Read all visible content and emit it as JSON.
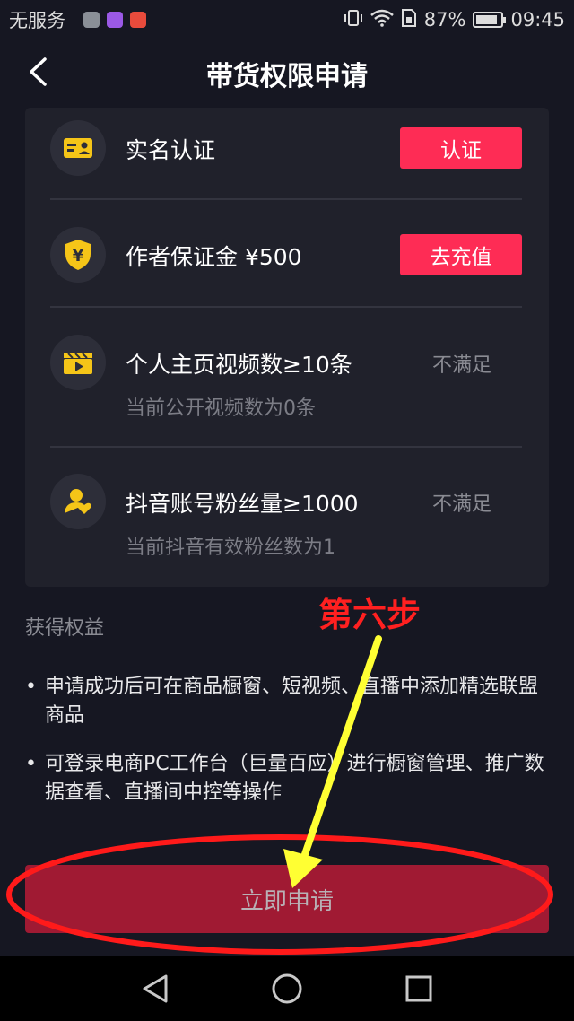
{
  "status_bar": {
    "carrier": "无服务",
    "battery": "87%",
    "battery_level": 0.87,
    "time": "09:45",
    "app_icon_colors": [
      "#8a8f97",
      "#9b59e6",
      "#e84b3c"
    ]
  },
  "header": {
    "title": "带货权限申请",
    "back_icon": "chevron-left-icon"
  },
  "requirements": [
    {
      "icon": "id-card-icon",
      "title": "实名认证",
      "action_label": "认证"
    },
    {
      "icon": "shield-yen-icon",
      "title": "作者保证金 ¥500",
      "action_label": "去充值"
    },
    {
      "icon": "video-clapper-icon",
      "title": "个人主页视频数≥10条",
      "subtitle": "当前公开视频数为0条",
      "status": "不满足"
    },
    {
      "icon": "fans-icon",
      "title": "抖音账号粉丝量≥1000",
      "subtitle": "当前抖音有效粉丝数为1",
      "status": "不满足"
    }
  ],
  "benefits": {
    "heading": "获得权益",
    "items": [
      "申请成功后可在商品橱窗、短视频、直播中添加精选联盟商品",
      "可登录电商PC工作台（巨量百应）进行橱窗管理、推广数据查看、直播间中控等操作"
    ]
  },
  "annotation": {
    "label": "第六步",
    "color": "#ff2020",
    "arrow_color": "#ffff33"
  },
  "apply_button": {
    "label": "立即申请"
  },
  "nav_bar": {
    "back_icon": "triangle-back-icon",
    "home_icon": "circle-home-icon",
    "recent_icon": "square-recent-icon"
  },
  "colors": {
    "background": "#161722",
    "card": "#20212b",
    "accent": "#fe2c55",
    "icon_yellow": "#f5c518"
  }
}
